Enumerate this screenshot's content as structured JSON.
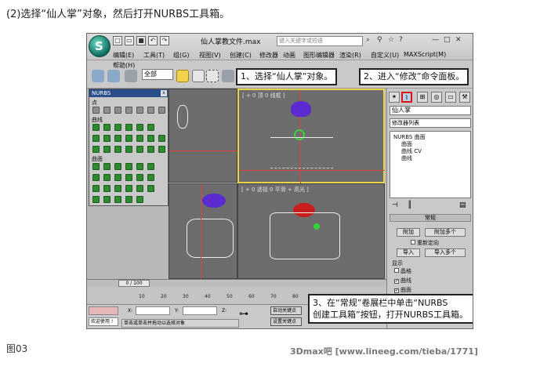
{
  "heading": "(2)选择“仙人掌”对象，然后打开NURBS工具箱。",
  "figure_label": "图03",
  "watermark": "3Dmax吧 [www.lineeg.com/tieba/1771]",
  "app": {
    "title": "仙人掌教文件.max",
    "search_placeholder": "键入关键字或短语",
    "menus": [
      "编辑(E)",
      "工具(T)",
      "组(G)",
      "视图(V)",
      "创建(C)",
      "修改器",
      "动画",
      "图形编辑器",
      "渲染(R)",
      "自定义(U)",
      "MAXScript(M)",
      "帮助(H)"
    ]
  },
  "toolbar": {
    "selection_filter": "全部"
  },
  "nurbs_panel": {
    "title": "NURBS",
    "close": "x",
    "sections": [
      "点",
      "曲线",
      "曲面"
    ]
  },
  "viewports": {
    "top_right_label": "[ + 0 顶 0 线框 ]",
    "bottom_right_label": "[ + 0 透视 0 平滑 + 高光 ]"
  },
  "command_panel": {
    "object_name": "仙人掌",
    "modifier_list": "修改器列表",
    "stack_items": [
      "NURBS 曲面",
      "曲面",
      "曲线 CV",
      "曲线"
    ],
    "rollout_title": "常规",
    "buttons": [
      "附加",
      "附加多个",
      "导入",
      "导入多个"
    ],
    "reorient_label": "重新定向",
    "display_label": "显示",
    "checkboxes": [
      "晶格",
      "曲线",
      "曲面"
    ]
  },
  "timeline": {
    "frame_counter": "0 / 100",
    "ticks": [
      "10",
      "20",
      "30",
      "40",
      "50",
      "60",
      "70",
      "80",
      "90",
      "100"
    ]
  },
  "status": {
    "welcome": "欢迎使用 !",
    "prompt": "单击或单击并拖动以选择对象",
    "x_label": "X:",
    "y_label": "Y:",
    "z_label": "Z:",
    "auto_key": "自动关键点",
    "set_key": "设置关键点"
  },
  "callouts": {
    "step1": "1、选择“仙人掌”对象。",
    "step2": "2、进入“修改”命令面板。",
    "step3_line1": "3、在“常规”卷展栏中单击“NURBS",
    "step3_line2": "创建工具箱”按钮，打开NURBS工具箱。"
  },
  "colors": {
    "accent_red": "#d11111",
    "nurbs_title": "#2a4e8a",
    "nurbs_green": "#2e8a2e",
    "object_purple": "#5b2ad0"
  }
}
